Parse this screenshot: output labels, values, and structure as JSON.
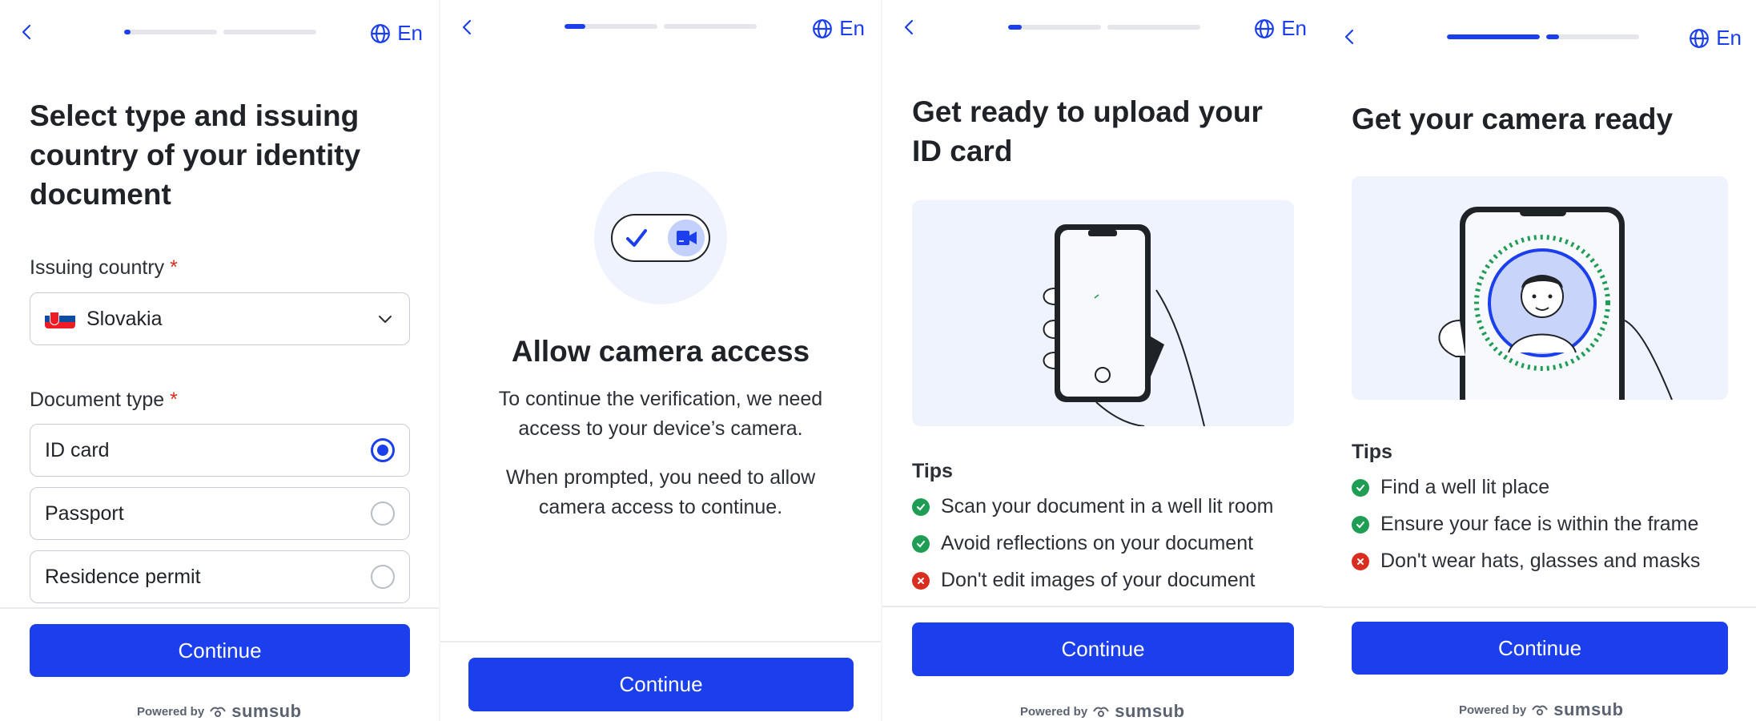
{
  "screens": [
    {
      "lang": "En",
      "progress": [
        0.07,
        0
      ],
      "title": "Select type and issuing country of your identity document",
      "country_label": "Issuing country",
      "required_mark": "*",
      "country_value": "Slovakia",
      "doctype_label": "Document type",
      "options": [
        {
          "label": "ID card",
          "selected": true
        },
        {
          "label": "Passport",
          "selected": false
        },
        {
          "label": "Residence permit",
          "selected": false
        }
      ],
      "continue": "Continue",
      "powered_by": "Powered by",
      "brand": "sumsub"
    },
    {
      "lang": "En",
      "progress": [
        0.22,
        0
      ],
      "title": "Allow camera access",
      "text1": "To continue the verification, we need access to your device’s camera.",
      "text2": "When prompted, you need to allow camera access to continue.",
      "continue": "Continue"
    },
    {
      "lang": "En",
      "progress": [
        0.15,
        0
      ],
      "title": "Get ready to upload your ID card",
      "tips_heading": "Tips",
      "tips": [
        {
          "text": "Scan your document in a well lit room",
          "ok": true
        },
        {
          "text": "Avoid reflections on your document",
          "ok": true
        },
        {
          "text": "Don't edit images of your document",
          "ok": false
        }
      ],
      "continue": "Continue",
      "powered_by": "Powered by",
      "brand": "sumsub"
    },
    {
      "lang": "En",
      "progress": [
        1,
        0.14
      ],
      "title": "Get your camera ready",
      "tips_heading": "Tips",
      "tips": [
        {
          "text": "Find a well lit place",
          "ok": true
        },
        {
          "text": "Ensure your face is within the frame",
          "ok": true
        },
        {
          "text": "Don't wear hats, glasses and masks",
          "ok": false
        }
      ],
      "continue": "Continue",
      "powered_by": "Powered by",
      "brand": "sumsub"
    }
  ],
  "colors": {
    "accent": "#1b3fec",
    "ok": "#1f9d55",
    "error": "#d92d20",
    "illustration_bg": "#eef3fd"
  },
  "icons": [
    "back-chevron-icon",
    "globe-icon",
    "chevron-down-icon",
    "check-circle-icon",
    "x-circle-icon",
    "camera-icon",
    "sumsub-logo-icon"
  ]
}
